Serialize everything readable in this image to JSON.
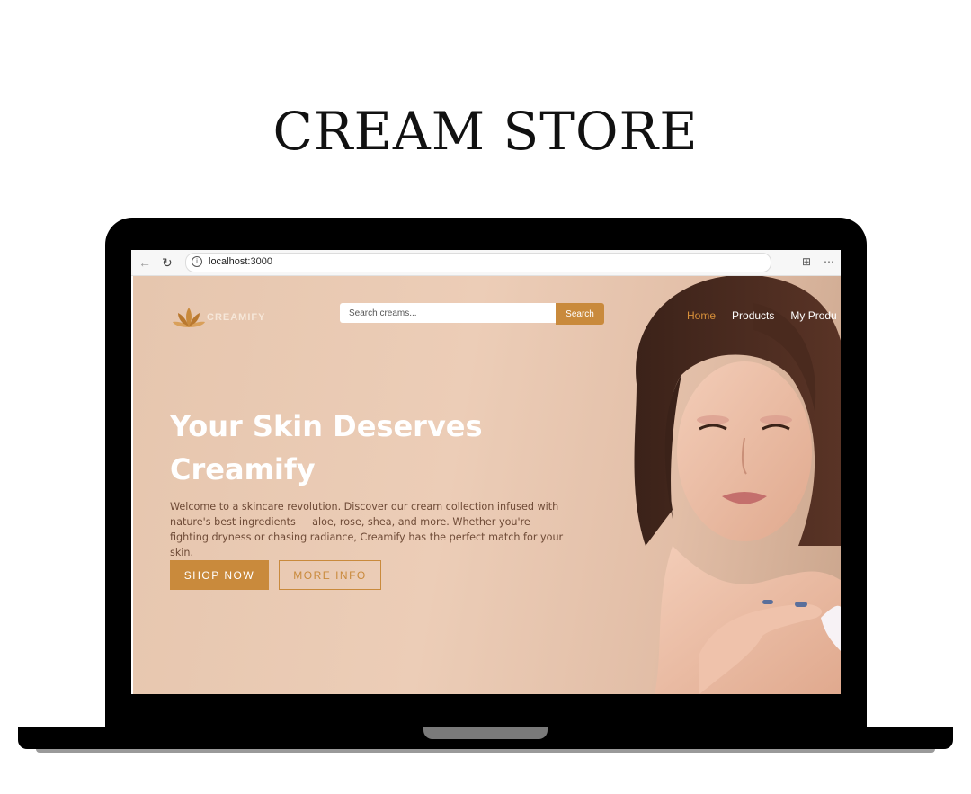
{
  "page": {
    "title": "CREAM STORE"
  },
  "browser": {
    "url": "localhost:3000",
    "back_icon": "←",
    "reload_icon": "↻",
    "info_icon": "i",
    "extensions_icon": "⊞",
    "more_icon": "⋯"
  },
  "site": {
    "logo_text": "CREAMIFY",
    "search": {
      "placeholder": "Search creams...",
      "button_label": "Search"
    },
    "nav": [
      {
        "label": "Home",
        "active": true
      },
      {
        "label": "Products",
        "active": false
      },
      {
        "label": "My Produ",
        "active": false
      }
    ],
    "hero": {
      "heading_line1": "Your Skin Deserves",
      "heading_line2": "Creamify",
      "text": "Welcome to a skincare revolution. Discover our cream collection infused with nature's best ingredients — aloe, rose, shea, and more. Whether you're fighting dryness or chasing radiance, Creamify has the perfect match for your skin.",
      "primary_button": "SHOP NOW",
      "secondary_button": "MORE INFO"
    }
  },
  "colors": {
    "accent": "#c98a3c",
    "hero_bg": "#e6c6ae",
    "active_nav": "#d8903a"
  }
}
